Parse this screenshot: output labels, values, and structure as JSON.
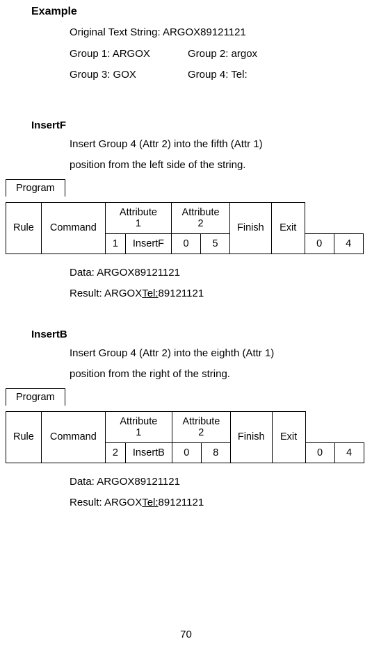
{
  "example": {
    "heading": "Example",
    "original": "Original Text String: ARGOX89121121",
    "group1": "Group 1: ARGOX",
    "group2": "Group 2: argox",
    "group3": "Group 3: GOX",
    "group4": "Group 4: Tel:"
  },
  "insertF": {
    "heading": "InsertF",
    "desc1": "Insert Group 4 (Attr 2) into the fifth (Attr 1)",
    "desc2": "position from the left side of the string.",
    "program_label": "Program",
    "table": {
      "rule_header": "Rule",
      "command_header": "Command",
      "attr1_header_l1": "Attribute",
      "attr1_header_l2": "1",
      "attr2_header_l1": "Attribute",
      "attr2_header_l2": "2",
      "finish_header": "Finish",
      "exit_header": "Exit",
      "row": {
        "rule": "1",
        "command": "InsertF",
        "a1a": "0",
        "a1b": "5",
        "a2a": "0",
        "a2b": "4"
      }
    },
    "data_line": "Data: ARGOX89121121",
    "result_prefix": "Result: ARGOX",
    "result_mid": "Tel:",
    "result_suffix": "89121121"
  },
  "insertB": {
    "heading": "InsertB",
    "desc1": "Insert Group 4 (Attr 2) into the eighth (Attr 1)",
    "desc2": "position from the right of the string.",
    "program_label": "Program",
    "table": {
      "rule_header": "Rule",
      "command_header": "Command",
      "attr1_header_l1": "Attribute",
      "attr1_header_l2": "1",
      "attr2_header_l1": "Attribute",
      "attr2_header_l2": "2",
      "finish_header": "Finish",
      "exit_header": "Exit",
      "row": {
        "rule": "2",
        "command": "InsertB",
        "a1a": "0",
        "a1b": "8",
        "a2a": "0",
        "a2b": "4"
      }
    },
    "data_line": "Data: ARGOX89121121",
    "result_prefix": "Result: ARGOX",
    "result_mid": "Tel:",
    "result_suffix": "89121121"
  },
  "page_number": "70"
}
